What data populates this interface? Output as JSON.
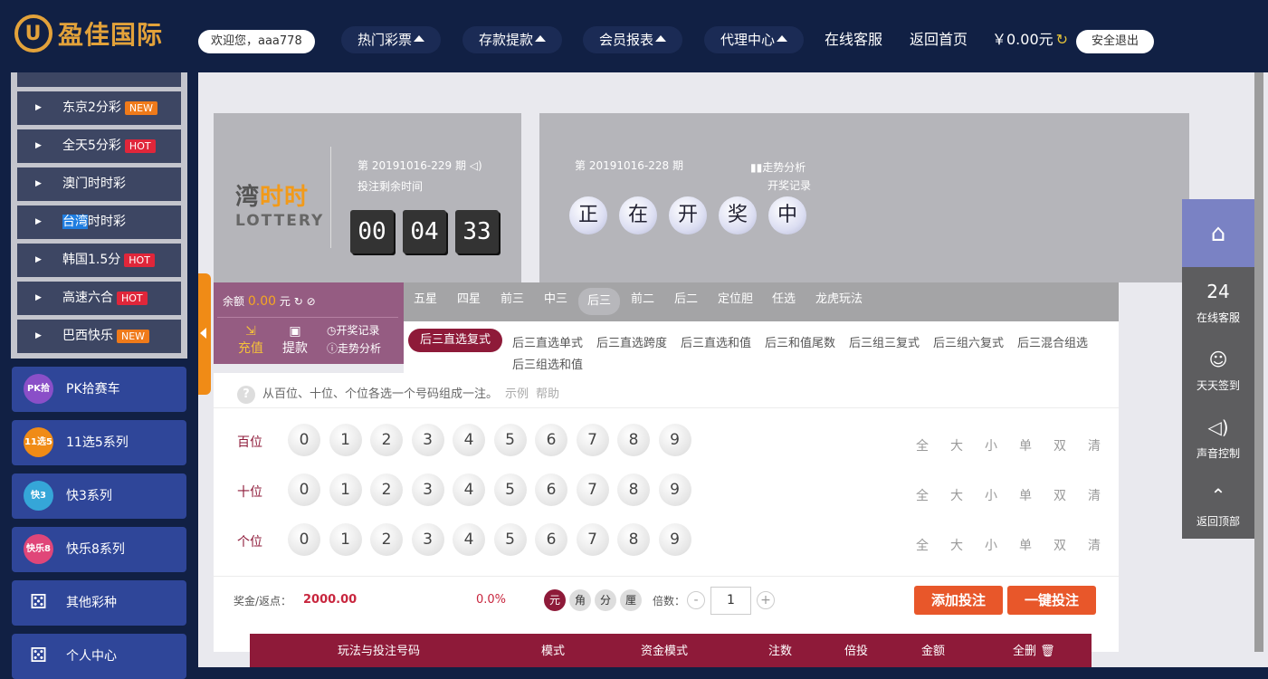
{
  "brand": {
    "name": "盈佳国际",
    "mark": "U"
  },
  "header": {
    "welcome": "欢迎您，aaa778",
    "nav": [
      {
        "label": "热门彩票"
      },
      {
        "label": "存款提款"
      },
      {
        "label": "会员报表"
      },
      {
        "label": "代理中心"
      }
    ],
    "service": "在线客服",
    "home": "返回首页",
    "balance": "￥0.00元",
    "logout": "安全退出"
  },
  "sidebar": {
    "sub_items": [
      {
        "label": "东京2分彩",
        "badge": "NEW"
      },
      {
        "label": "全天5分彩",
        "badge": "HOT"
      },
      {
        "label": "澳门时时彩",
        "badge": ""
      },
      {
        "label_hl": "台湾",
        "label_rest": "时时彩",
        "badge": ""
      },
      {
        "label": "韩国1.5分",
        "badge": "HOT"
      },
      {
        "label": "高速六合",
        "badge": "HOT"
      },
      {
        "label": "巴西快乐",
        "badge": "NEW"
      }
    ],
    "categories": [
      {
        "label": "PK拾赛车",
        "icon": "PK拾"
      },
      {
        "label": "11选5系列",
        "icon": "11选5"
      },
      {
        "label": "快3系列",
        "icon": "快3"
      },
      {
        "label": "快乐8系列",
        "icon": "快乐8"
      },
      {
        "label": "其他彩种",
        "icon": "dice"
      },
      {
        "label": "个人中心",
        "icon": "dice"
      }
    ]
  },
  "game": {
    "logo_a": "湾",
    "logo_b": "时时",
    "logo_sub": "LOTTERY",
    "current_issue": "第 20191016-229 期",
    "countdown_label": "投注剩余时间",
    "countdown": [
      "00",
      "04",
      "33"
    ],
    "last_issue": "第 20191016-228 期",
    "trend": "走势分析",
    "history": "开奖记录",
    "drawing": [
      "正",
      "在",
      "开",
      "奖",
      "中"
    ]
  },
  "balance_box": {
    "label": "余额",
    "amount": "0.00",
    "unit": "元",
    "recharge": "充值",
    "withdraw": "提款",
    "history": "开奖记录",
    "trend": "走势分析"
  },
  "tabs": [
    "五星",
    "四星",
    "前三",
    "中三",
    "后三",
    "前二",
    "后二",
    "定位胆",
    "任选",
    "龙虎玩法"
  ],
  "active_tab": "后三",
  "subtabs": [
    "后三直选复式",
    "后三直选单式",
    "后三直选跨度",
    "后三直选和值",
    "后三和值尾数",
    "后三组三复式",
    "后三组六复式",
    "后三混合组选",
    "后三组选和值"
  ],
  "hint": {
    "text": "从百位、十位、个位各选一个号码组成一注。",
    "example": "示例",
    "help": "帮助"
  },
  "positions": [
    "百位",
    "十位",
    "个位"
  ],
  "numbers": [
    "0",
    "1",
    "2",
    "3",
    "4",
    "5",
    "6",
    "7",
    "8",
    "9"
  ],
  "quick": [
    "全",
    "大",
    "小",
    "单",
    "双",
    "清"
  ],
  "footer": {
    "prize_label": "奖金/返点：",
    "prize": "2000.00",
    "rebate": "0.0%",
    "units": [
      "元",
      "角",
      "分",
      "厘"
    ],
    "multiplier_label": "倍数：",
    "multiplier": "1",
    "minus": "-",
    "plus": "+",
    "add_bet": "添加投注",
    "quick_bet": "一键投注"
  },
  "bet_table": {
    "columns": [
      "玩法与投注号码",
      "模式",
      "资金模式",
      "注数",
      "倍投",
      "金额",
      "全删"
    ]
  },
  "float": {
    "home": "⌂",
    "items": [
      {
        "label": "在线客服",
        "icon": "24"
      },
      {
        "label": "天天签到",
        "icon": "☺"
      },
      {
        "label": "声音控制",
        "icon": "◁)"
      },
      {
        "label": "返回顶部",
        "icon": "⌃"
      }
    ]
  },
  "colors": {
    "accent": "#8e1a39",
    "navy": "#112044",
    "orange": "#e8572a",
    "gold": "#e3a23a"
  }
}
